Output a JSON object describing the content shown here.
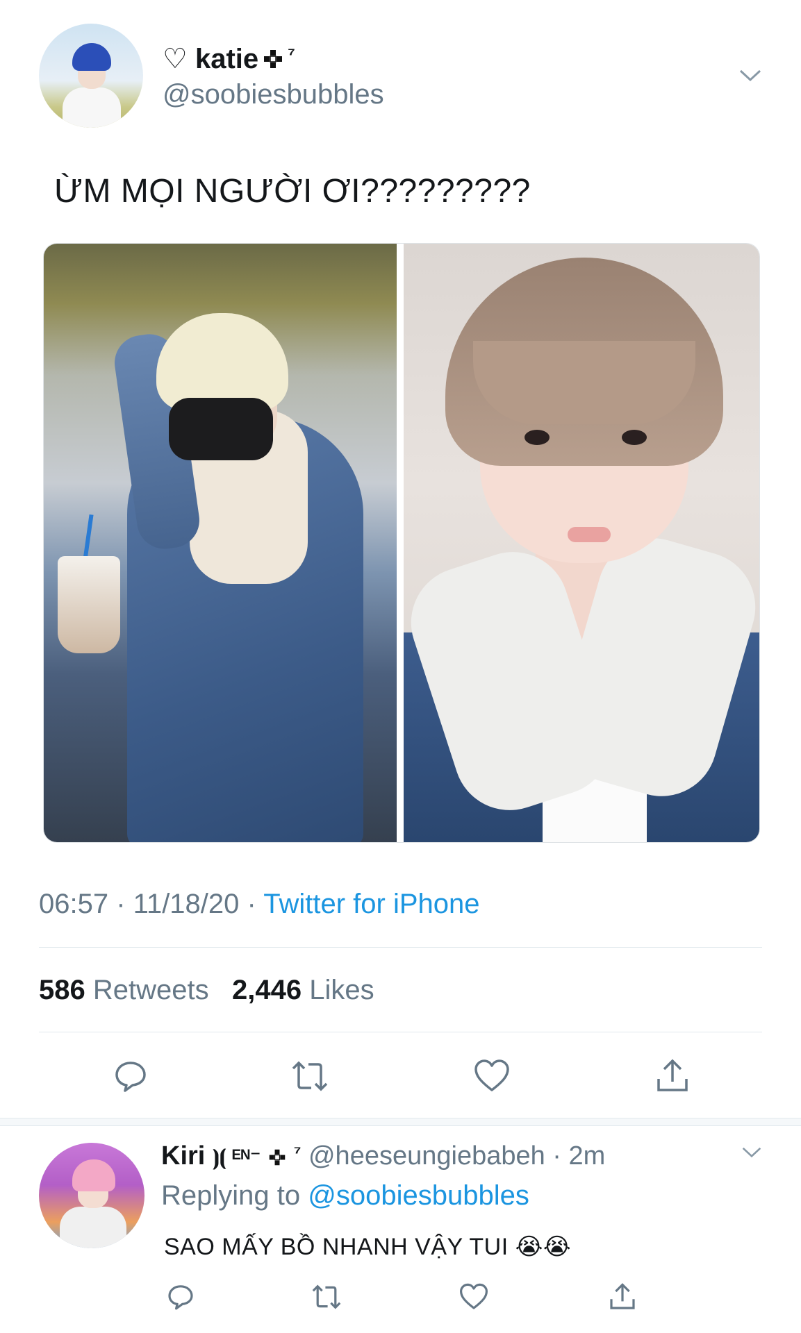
{
  "tweet": {
    "display_name": "♡ katie",
    "name_suffix": "⁷",
    "handle": "@soobiesbubbles",
    "text": "ỪM MỌI NGƯỜI ƠI?????????",
    "time": "06:57",
    "date": "11/18/20",
    "source": "Twitter for iPhone",
    "retweets_count": "586",
    "retweets_label": "Retweets",
    "likes_count": "2,446",
    "likes_label": "Likes"
  },
  "reply": {
    "display_name": "Kiri",
    "name_decor": "⦘⦗ ᴱᴺ⁻",
    "name_suffix": "⁷",
    "handle": "@heeseungiebabeh",
    "age": "2m",
    "replying_label": "Replying to",
    "replying_to": "@soobiesbubbles",
    "text": "SAO MẤY BỒ NHANH VẬY TUI 😭😭"
  },
  "colors": {
    "accent": "#1b95e0",
    "muted": "#657786",
    "text": "#14171a",
    "divider": "#e1e8ed"
  },
  "icons": [
    "chevron-down-icon",
    "reply-icon",
    "retweet-icon",
    "like-icon",
    "share-icon",
    "heart-outline-icon",
    "sparkle-icon"
  ]
}
